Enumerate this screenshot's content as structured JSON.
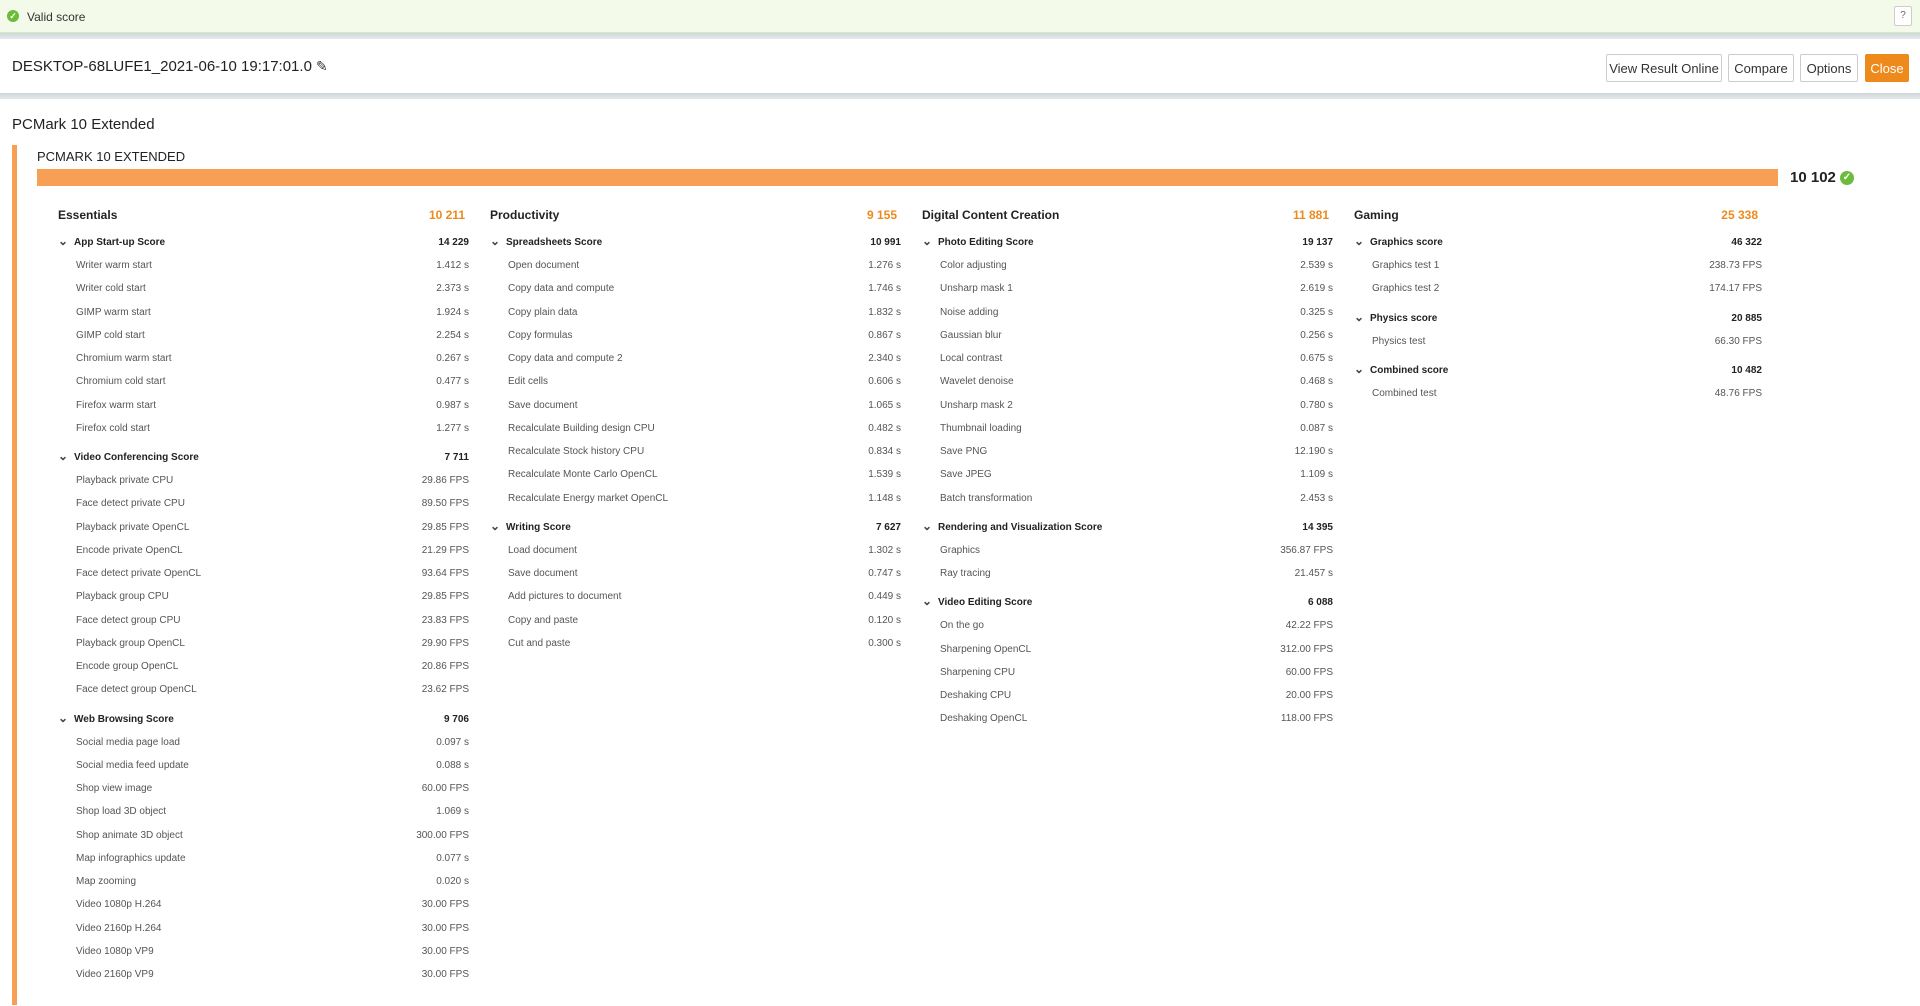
{
  "banner": {
    "text": "Valid score",
    "help": "?"
  },
  "header": {
    "title": "DESKTOP-68LUFE1_2021-06-10 19:17:01.0",
    "view_online": "View Result Online",
    "compare": "Compare",
    "options": "Options",
    "close": "Close"
  },
  "page_title": "PCMark 10 Extended",
  "card": {
    "title": "PCMARK 10 EXTENDED",
    "total": "10 102",
    "progress_fraction": 1.0,
    "accent": "#f7a055",
    "valid_color": "#6dbb3d"
  },
  "columns": [
    {
      "name": "Essentials",
      "score": "10 211",
      "groups": [
        {
          "name": "App Start-up Score",
          "score": "14 229",
          "rows": [
            [
              "Writer warm start",
              "1.412 s"
            ],
            [
              "Writer cold start",
              "2.373 s"
            ],
            [
              "GIMP warm start",
              "1.924 s"
            ],
            [
              "GIMP cold start",
              "2.254 s"
            ],
            [
              "Chromium warm start",
              "0.267 s"
            ],
            [
              "Chromium cold start",
              "0.477 s"
            ],
            [
              "Firefox warm start",
              "0.987 s"
            ],
            [
              "Firefox cold start",
              "1.277 s"
            ]
          ]
        },
        {
          "name": "Video Conferencing Score",
          "score": "7 711",
          "rows": [
            [
              "Playback private CPU",
              "29.86 FPS"
            ],
            [
              "Face detect private CPU",
              "89.50 FPS"
            ],
            [
              "Playback private OpenCL",
              "29.85 FPS"
            ],
            [
              "Encode private OpenCL",
              "21.29 FPS"
            ],
            [
              "Face detect private OpenCL",
              "93.64 FPS"
            ],
            [
              "Playback group CPU",
              "29.85 FPS"
            ],
            [
              "Face detect group CPU",
              "23.83 FPS"
            ],
            [
              "Playback group OpenCL",
              "29.90 FPS"
            ],
            [
              "Encode group OpenCL",
              "20.86 FPS"
            ],
            [
              "Face detect group OpenCL",
              "23.62 FPS"
            ]
          ]
        },
        {
          "name": "Web Browsing Score",
          "score": "9 706",
          "rows": [
            [
              "Social media page load",
              "0.097 s"
            ],
            [
              "Social media feed update",
              "0.088 s"
            ],
            [
              "Shop view image",
              "60.00 FPS"
            ],
            [
              "Shop load 3D object",
              "1.069 s"
            ],
            [
              "Shop animate 3D object",
              "300.00 FPS"
            ],
            [
              "Map infographics update",
              "0.077 s"
            ],
            [
              "Map zooming",
              "0.020 s"
            ],
            [
              "Video 1080p H.264",
              "30.00 FPS"
            ],
            [
              "Video 2160p H.264",
              "30.00 FPS"
            ],
            [
              "Video 1080p VP9",
              "30.00 FPS"
            ],
            [
              "Video 2160p VP9",
              "30.00 FPS"
            ]
          ]
        }
      ]
    },
    {
      "name": "Productivity",
      "score": "9 155",
      "groups": [
        {
          "name": "Spreadsheets Score",
          "score": "10 991",
          "rows": [
            [
              "Open document",
              "1.276 s"
            ],
            [
              "Copy data and compute",
              "1.746 s"
            ],
            [
              "Copy plain data",
              "1.832 s"
            ],
            [
              "Copy formulas",
              "0.867 s"
            ],
            [
              "Copy data and compute 2",
              "2.340 s"
            ],
            [
              "Edit cells",
              "0.606 s"
            ],
            [
              "Save document",
              "1.065 s"
            ],
            [
              "Recalculate Building design CPU",
              "0.482 s"
            ],
            [
              "Recalculate Stock history CPU",
              "0.834 s"
            ],
            [
              "Recalculate Monte Carlo OpenCL",
              "1.539 s"
            ],
            [
              "Recalculate Energy market OpenCL",
              "1.148 s"
            ]
          ]
        },
        {
          "name": "Writing Score",
          "score": "7 627",
          "rows": [
            [
              "Load document",
              "1.302 s"
            ],
            [
              "Save document",
              "0.747 s"
            ],
            [
              "Add pictures to document",
              "0.449 s"
            ],
            [
              "Copy and paste",
              "0.120 s"
            ],
            [
              "Cut and paste",
              "0.300 s"
            ]
          ]
        }
      ]
    },
    {
      "name": "Digital Content Creation",
      "score": "11 881",
      "groups": [
        {
          "name": "Photo Editing Score",
          "score": "19 137",
          "rows": [
            [
              "Color adjusting",
              "2.539 s"
            ],
            [
              "Unsharp mask 1",
              "2.619 s"
            ],
            [
              "Noise adding",
              "0.325 s"
            ],
            [
              "Gaussian blur",
              "0.256 s"
            ],
            [
              "Local contrast",
              "0.675 s"
            ],
            [
              "Wavelet denoise",
              "0.468 s"
            ],
            [
              "Unsharp mask 2",
              "0.780 s"
            ],
            [
              "Thumbnail loading",
              "0.087 s"
            ],
            [
              "Save PNG",
              "12.190 s"
            ],
            [
              "Save JPEG",
              "1.109 s"
            ],
            [
              "Batch transformation",
              "2.453 s"
            ]
          ]
        },
        {
          "name": "Rendering and Visualization Score",
          "score": "14 395",
          "rows": [
            [
              "Graphics",
              "356.87 FPS"
            ],
            [
              "Ray tracing",
              "21.457 s"
            ]
          ]
        },
        {
          "name": "Video Editing Score",
          "score": "6 088",
          "rows": [
            [
              "On the go",
              "42.22 FPS"
            ],
            [
              "Sharpening OpenCL",
              "312.00 FPS"
            ],
            [
              "Sharpening CPU",
              "60.00 FPS"
            ],
            [
              "Deshaking CPU",
              "20.00 FPS"
            ],
            [
              "Deshaking OpenCL",
              "118.00 FPS"
            ]
          ]
        }
      ]
    },
    {
      "name": "Gaming",
      "score": "25 338",
      "groups": [
        {
          "name": "Graphics score",
          "score": "46 322",
          "rows": [
            [
              "Graphics test 1",
              "238.73 FPS"
            ],
            [
              "Graphics test 2",
              "174.17 FPS"
            ]
          ]
        },
        {
          "name": "Physics score",
          "score": "20 885",
          "rows": [
            [
              "Physics test",
              "66.30 FPS"
            ]
          ]
        },
        {
          "name": "Combined score",
          "score": "10 482",
          "rows": [
            [
              "Combined test",
              "48.76 FPS"
            ]
          ]
        }
      ]
    }
  ]
}
